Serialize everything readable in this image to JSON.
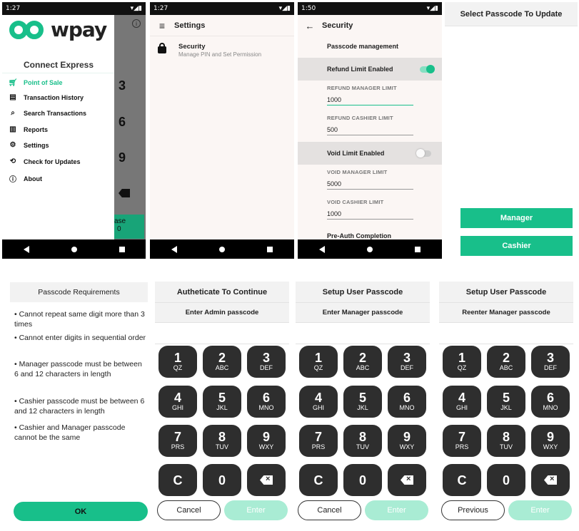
{
  "screen1": {
    "status_time": "1:27",
    "logo_text": "wpay",
    "app_title": "Connect Express",
    "menu": [
      {
        "label": "Point of Sale",
        "icon": "cart-icon"
      },
      {
        "label": "Transaction History",
        "icon": "receipt-icon"
      },
      {
        "label": "Search Transactions",
        "icon": "search-icon"
      },
      {
        "label": "Reports",
        "icon": "bar-chart-icon"
      },
      {
        "label": "Settings",
        "icon": "gear-icon"
      },
      {
        "label": "Check for Updates",
        "icon": "sync-icon"
      },
      {
        "label": "About",
        "icon": "info-icon"
      }
    ],
    "behind_keys": [
      "3",
      "6",
      "9"
    ],
    "behind_btn_1": "ase",
    "behind_btn_2": "0",
    "accent": "#18bf8a"
  },
  "screen2": {
    "status_time": "1:27",
    "title": "Settings",
    "item_title": "Security",
    "item_subtitle": "Manage PIN and Set Permission"
  },
  "screen3": {
    "status_time": "1:50",
    "title": "Security",
    "section": "Passcode management",
    "refund_toggle_label": "Refund Limit Enabled",
    "refund_enabled": true,
    "refund_manager_label": "REFUND MANAGER LIMIT",
    "refund_manager_value": "1000",
    "refund_cashier_label": "REFUND CASHIER LIMIT",
    "refund_cashier_value": "500",
    "void_toggle_label": "Void Limit Enabled",
    "void_enabled": false,
    "void_manager_label": "VOID MANAGER LIMIT",
    "void_manager_value": "5000",
    "void_cashier_label": "VOID CASHIER LIMIT",
    "void_cashier_value": "1000",
    "next_section": "Pre-Auth Completion"
  },
  "screen4": {
    "title": "Select Passcode To Update",
    "manager_btn": "Manager",
    "cashier_btn": "Cashier"
  },
  "requirements": {
    "title": "Passcode Requirements",
    "items": [
      "• Cannot repeat same digit more than 3 times",
      "• Cannot enter digits in sequential order",
      "• Manager passcode must be between 6 and 12 characters in length",
      "• Cashier passcode must be between 6 and 12 characters in length",
      "• Cashier and Manager passcode cannot be the same"
    ],
    "ok_btn": "OK"
  },
  "keypad": [
    {
      "digit": "1",
      "sub": "QZ"
    },
    {
      "digit": "2",
      "sub": "ABC"
    },
    {
      "digit": "3",
      "sub": "DEF"
    },
    {
      "digit": "4",
      "sub": "GHI"
    },
    {
      "digit": "5",
      "sub": "JKL"
    },
    {
      "digit": "6",
      "sub": "MNO"
    },
    {
      "digit": "7",
      "sub": "PRS"
    },
    {
      "digit": "8",
      "sub": "TUV"
    },
    {
      "digit": "9",
      "sub": "WXY"
    },
    {
      "digit": "C",
      "sub": ""
    },
    {
      "digit": "0",
      "sub": ""
    },
    {
      "digit": "",
      "sub": "",
      "icon": "backspace-icon"
    }
  ],
  "pads": [
    {
      "title": "Autheticate To Continue",
      "prompt": "Enter Admin passcode",
      "left_btn": "Cancel",
      "right_btn": "Enter"
    },
    {
      "title": "Setup User Passcode",
      "prompt": "Enter Manager passcode",
      "left_btn": "Cancel",
      "right_btn": "Enter"
    },
    {
      "title": "Setup User Passcode",
      "prompt": "Reenter Manager passcode",
      "left_btn": "Previous",
      "right_btn": "Enter"
    }
  ]
}
